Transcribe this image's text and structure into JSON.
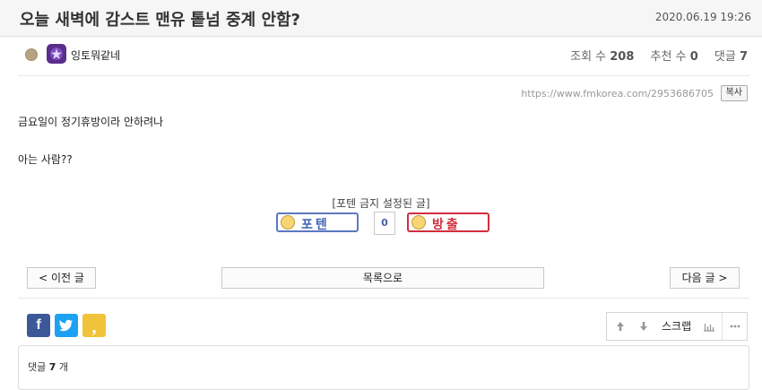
{
  "post": {
    "title": "오늘 새벽에 감스트 맨유 톹넘 중계 안함?",
    "date": "2020.06.19 19:26",
    "author": "잉토뭐같네",
    "url": "https://www.fmkorea.com/2953686705",
    "copy_label": "복사",
    "body_lines": [
      "금요일이 정기휴방이라 안하려나",
      "아는 사람??"
    ]
  },
  "stats": {
    "views_label": "조회 수",
    "views": "208",
    "recommends_label": "추천 수",
    "recommends": "0",
    "comments_label": "댓글",
    "comments": "7"
  },
  "vote": {
    "caption": "[포텐 금지 설정된 글]",
    "popular_label": "포텐",
    "count": "0",
    "bomb_label": "방출"
  },
  "nav": {
    "prev_label": "< 이전 글",
    "list_label": "목록으로",
    "next_label": "다음 글 >"
  },
  "share": {
    "kakao_glyph": ","
  },
  "tools": {
    "scrap_label": "스크랩"
  },
  "comments": {
    "label": "댓글",
    "count": "7",
    "unit": "개"
  },
  "icons": {
    "level": "level-dot-icon",
    "avatar": "profile-avatar",
    "facebook": "facebook-icon",
    "twitter": "twitter-icon",
    "kakao": "kakaostory-icon",
    "up": "arrow-up-icon",
    "down": "arrow-down-icon",
    "stats": "bar-chart-icon",
    "more": "more-dots-icon"
  },
  "colors": {
    "popular_border": "#5b79c0",
    "bomb_border": "#d22d3d",
    "facebook": "#3b5998",
    "twitter": "#1da1f2",
    "kakao": "#f0c33a"
  }
}
